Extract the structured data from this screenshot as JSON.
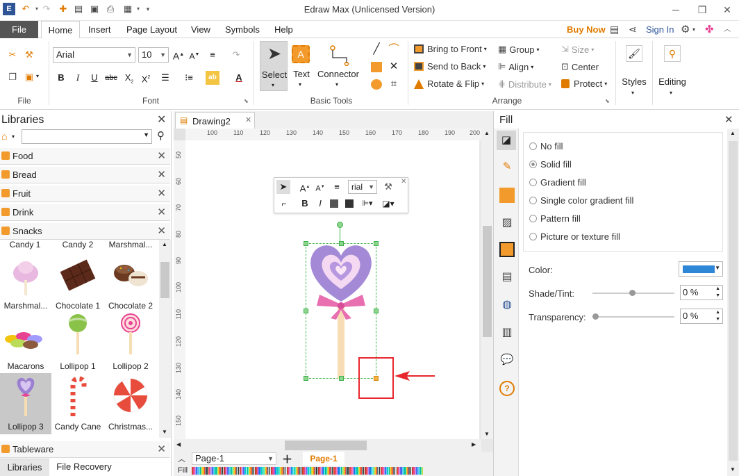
{
  "window": {
    "title": "Edraw Max (Unlicensed Version)"
  },
  "menu": {
    "file": "File",
    "tabs": [
      "Home",
      "Insert",
      "Page Layout",
      "View",
      "Symbols",
      "Help"
    ],
    "buy_now": "Buy Now",
    "sign_in": "Sign In"
  },
  "ribbon": {
    "file_group": "File",
    "font_group": "Font",
    "font_name": "Arial",
    "font_size": "10",
    "basic_tools_group": "Basic Tools",
    "select": "Select",
    "text": "Text",
    "connector": "Connector",
    "arrange_group": "Arrange",
    "bring_to_front": "Bring to Front",
    "send_to_back": "Send to Back",
    "rotate_flip": "Rotate & Flip",
    "group": "Group",
    "align": "Align",
    "distribute": "Distribute",
    "size": "Size",
    "center": "Center",
    "protect": "Protect",
    "styles": "Styles",
    "editing": "Editing"
  },
  "libraries": {
    "title": "Libraries",
    "categories_top": [
      "Food",
      "Bread",
      "Fruit",
      "Drink",
      "Snacks"
    ],
    "items": [
      {
        "label": "Candy 1"
      },
      {
        "label": "Candy 2"
      },
      {
        "label": "Marshmal..."
      },
      {
        "label": "Marshmal..."
      },
      {
        "label": "Chocolate 1"
      },
      {
        "label": "Chocolate 2"
      },
      {
        "label": "Macarons"
      },
      {
        "label": "Lollipop 1"
      },
      {
        "label": "Lollipop 2"
      },
      {
        "label": "Lollipop 3"
      },
      {
        "label": "Candy Cane"
      },
      {
        "label": "Christmas..."
      }
    ],
    "bottom_category": "Tableware",
    "tab_libraries": "Libraries",
    "tab_recovery": "File Recovery"
  },
  "document": {
    "tab": "Drawing2",
    "ruler_h": [
      "100",
      "110",
      "120",
      "130",
      "140",
      "150",
      "160",
      "170",
      "180",
      "190",
      "200"
    ],
    "ruler_v": [
      "50",
      "60",
      "70",
      "80",
      "90",
      "100",
      "110",
      "120",
      "130",
      "140",
      "150"
    ],
    "floating_font": "rial",
    "page_select": "Page-1",
    "page_tab": "Page-1",
    "fill_label": "Fill"
  },
  "fill": {
    "title": "Fill",
    "options": [
      "No fill",
      "Solid fill",
      "Gradient fill",
      "Single color gradient fill",
      "Pattern fill",
      "Picture or texture fill"
    ],
    "selected_option": "Solid fill",
    "color_label": "Color:",
    "color_value": "#2e86d6",
    "shade_label": "Shade/Tint:",
    "shade_value": "0 %",
    "transparency_label": "Transparency:",
    "transparency_value": "0 %"
  },
  "palette": [
    "#c0392b",
    "#e74c3c",
    "#e84393",
    "#fd79a8",
    "#a29bfe",
    "#6c5ce7",
    "#0984e3",
    "#74b9ff",
    "#00cec9",
    "#81ecec",
    "#00b894",
    "#55efc4",
    "#badc58",
    "#f9ca24",
    "#f0932b",
    "#eb4d4b",
    "#636e72",
    "#b2bec3",
    "#2d3436",
    "#dfe6e9"
  ]
}
